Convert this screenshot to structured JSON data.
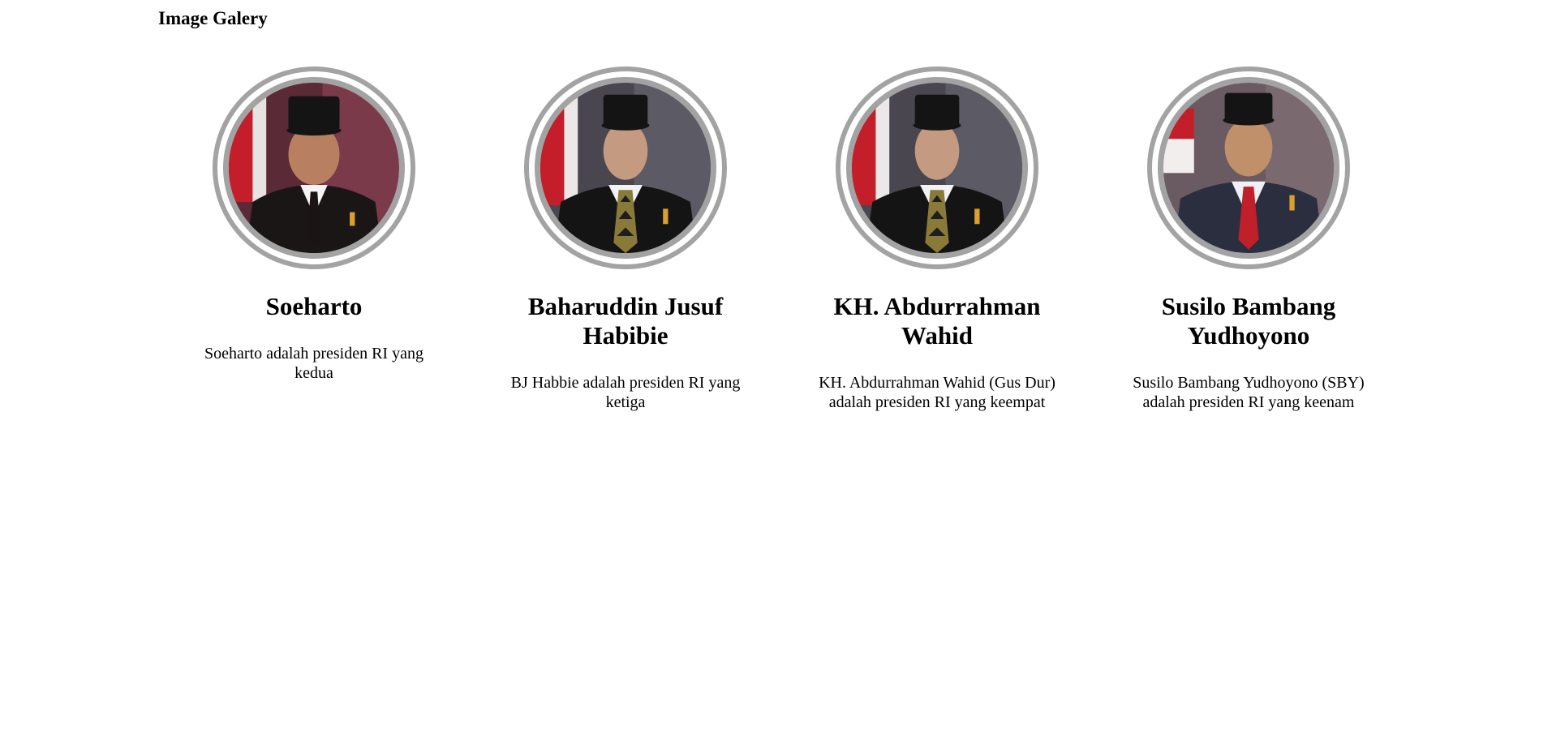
{
  "page": {
    "title": "Image Galery"
  },
  "gallery": {
    "items": [
      {
        "name": "Soeharto",
        "description": "Soeharto adalah presiden RI yang kedua",
        "portrait": "portrait-soeharto",
        "colors": {
          "background": "#7a3a4a",
          "suit": "#1a1616",
          "tie": "#1a1414"
        }
      },
      {
        "name": "Baharuddin Jusuf Habibie",
        "description": "BJ Habbie adalah presiden RI yang ketiga",
        "portrait": "portrait-habibie",
        "colors": {
          "background": "#4a4650",
          "suit": "#141414",
          "tie": "#8a7a3a"
        }
      },
      {
        "name": "KH. Abdurrahman Wahid",
        "description": "KH. Abdurrahman Wahid (Gus Dur) adalah presiden RI yang keempat",
        "portrait": "portrait-habibie",
        "colors": {
          "background": "#4a4650",
          "suit": "#141414",
          "tie": "#8a7a3a"
        }
      },
      {
        "name": "Susilo Bambang Yudhoyono",
        "description": "Susilo Bambang Yudhoyono (SBY) adalah presiden RI yang keenam",
        "portrait": "portrait-sby",
        "colors": {
          "background": "#6a5a62",
          "suit": "#2a2e3e",
          "tie": "#c0202a"
        }
      }
    ]
  }
}
